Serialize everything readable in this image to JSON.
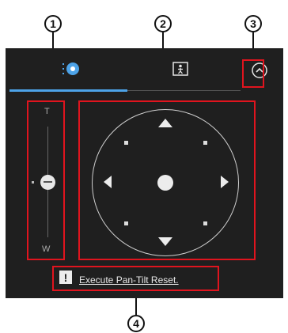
{
  "callouts": [
    "1",
    "2",
    "3",
    "4"
  ],
  "tabs": [
    {
      "name": "ptz",
      "icon": "ptz-icon"
    },
    {
      "name": "preset",
      "icon": "person-frame-icon"
    }
  ],
  "zoom": {
    "tele_label": "T",
    "wide_label": "W"
  },
  "reset": {
    "label": "Execute Pan-Tilt Reset.",
    "warning_symbol": "!"
  },
  "colors": {
    "accent": "#4da3e8",
    "highlight": "#e0141e",
    "panel": "#1f1f1f"
  }
}
